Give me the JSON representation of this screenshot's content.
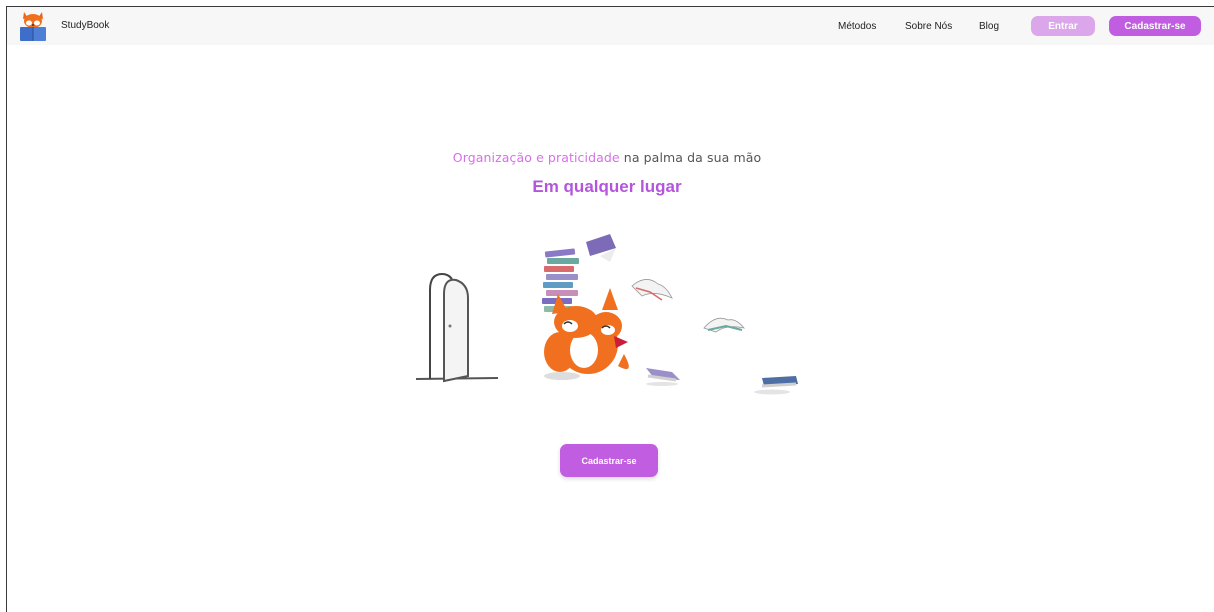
{
  "header": {
    "brand": "StudyBook",
    "nav": [
      "Métodos",
      "Sobre Nós",
      "Blog"
    ],
    "login_label": "Entrar",
    "signup_label": "Cadastrar-se"
  },
  "hero": {
    "tagline_accent": "Organização e praticidade",
    "tagline_rest": " na palma da sua mão",
    "headline": "Em qualquer lugar",
    "cta_label": "Cadastrar-se"
  },
  "colors": {
    "primary": "#c05de0",
    "primary_light": "#dca6ea",
    "accent_text": "#d86fe8",
    "headline": "#b455dd",
    "fox_orange": "#f0701f"
  },
  "icons": {
    "logo": "fox-reading-book-icon",
    "illustration": "fox-with-books-and-door"
  }
}
